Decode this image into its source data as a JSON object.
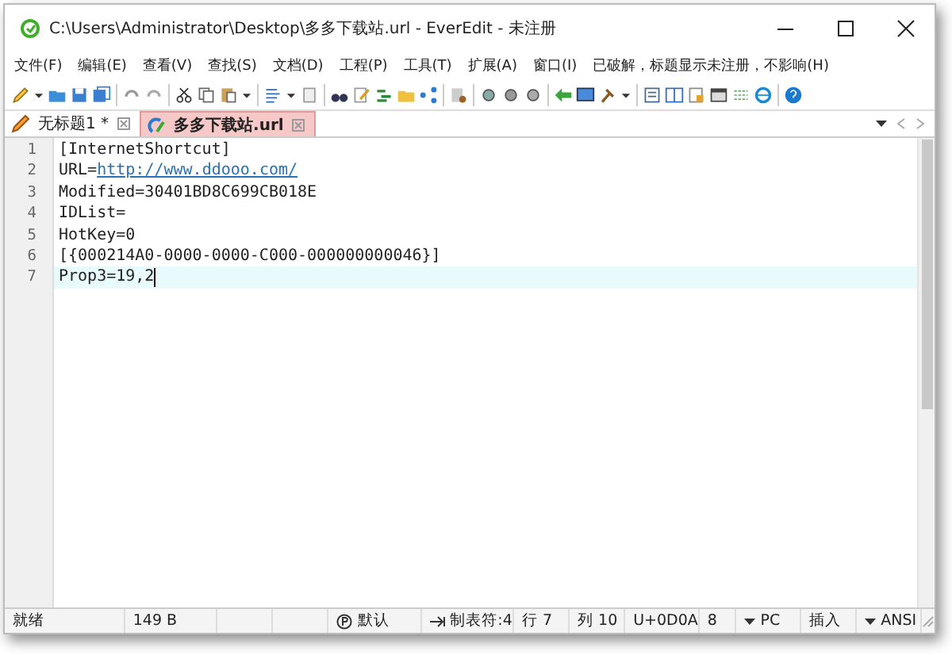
{
  "window": {
    "title": "C:\\Users\\Administrator\\Desktop\\多多下载站.url - EverEdit - 未注册"
  },
  "menu": {
    "items": [
      "文件(F)",
      "编辑(E)",
      "查看(V)",
      "查找(S)",
      "文档(D)",
      "工程(P)",
      "工具(T)",
      "扩展(A)",
      "窗口(I)"
    ],
    "note": "已破解，标题显示未注册，不影响(H)"
  },
  "tabs": [
    {
      "label": "无标题1 *",
      "selected": false
    },
    {
      "label": "多多下载站.url",
      "selected": true
    }
  ],
  "editor": {
    "lines": [
      {
        "number": "1",
        "text": "[InternetShortcut]",
        "current": false
      },
      {
        "number": "2",
        "text": "URL=",
        "link": "http://www.ddooo.com/",
        "current": false
      },
      {
        "number": "3",
        "text": "Modified=30401BD8C699CB018E",
        "current": false
      },
      {
        "number": "4",
        "text": "IDList=",
        "current": false
      },
      {
        "number": "5",
        "text": "HotKey=0",
        "current": false
      },
      {
        "number": "6",
        "text": "[{000214A0-0000-0000-C000-000000000046}]",
        "current": false
      },
      {
        "number": "7",
        "text": "Prop3=19,2",
        "current": true
      }
    ]
  },
  "status_bar": [
    {
      "kind": "text",
      "text": "就绪"
    },
    {
      "kind": "text",
      "text": "149 B"
    },
    {
      "kind": "empty"
    },
    {
      "kind": "empty"
    },
    {
      "kind": "icon",
      "text": "默认"
    },
    {
      "kind": "tab",
      "text": "制表符:4"
    },
    {
      "kind": "text",
      "text": "行 7"
    },
    {
      "kind": "text",
      "text": "列 10"
    },
    {
      "kind": "text",
      "text": "U+0D0A"
    },
    {
      "kind": "text",
      "text": "8"
    },
    {
      "kind": "dropdown",
      "text": "PC"
    },
    {
      "kind": "text",
      "text": "插入"
    },
    {
      "kind": "dropdown",
      "text": "ANSI"
    }
  ]
}
